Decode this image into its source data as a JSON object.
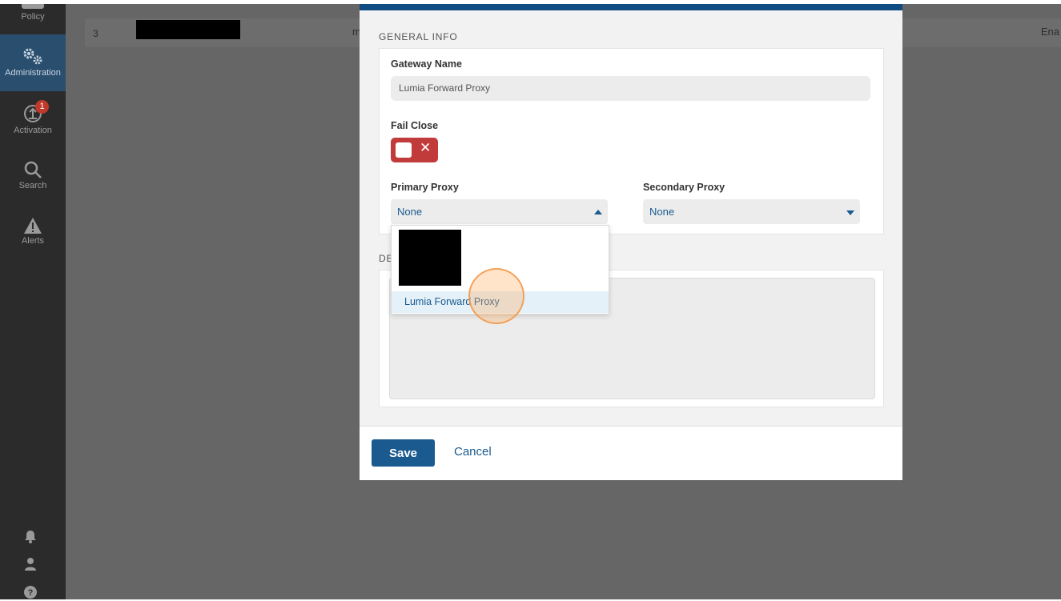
{
  "sidebar": {
    "items": [
      {
        "label": "Policy",
        "icon": "policy-icon"
      },
      {
        "label": "Administration",
        "icon": "gears-icon",
        "active": true
      },
      {
        "label": "Activation",
        "icon": "upload-icon",
        "badge": "1"
      },
      {
        "label": "Search",
        "icon": "search-icon"
      },
      {
        "label": "Alerts",
        "icon": "warning-icon"
      }
    ],
    "bottom_icons": [
      "bell-icon",
      "user-icon",
      "help-icon"
    ]
  },
  "background_table": {
    "row": {
      "index": "3",
      "col_fragment": "m",
      "status_fragment": "Ena"
    }
  },
  "modal": {
    "section_general": "GENERAL INFO",
    "gateway_name_label": "Gateway Name",
    "gateway_name_value": "Lumia Forward Proxy",
    "fail_close_label": "Fail Close",
    "fail_close_enabled": false,
    "primary_proxy_label": "Primary Proxy",
    "primary_proxy_value": "None",
    "primary_proxy_options": [
      "Lumia Forward Proxy"
    ],
    "secondary_proxy_label": "Secondary Proxy",
    "secondary_proxy_value": "None",
    "section_description_fragment": "DE",
    "save_label": "Save",
    "cancel_label": "Cancel"
  },
  "colors": {
    "accent": "#1b5a8f",
    "header_bar": "#0f4c81",
    "toggle_off": "#c23b3b",
    "sidebar_bg": "#2b2b2b",
    "sidebar_active": "#2a4e6e",
    "badge": "#c0392b"
  }
}
